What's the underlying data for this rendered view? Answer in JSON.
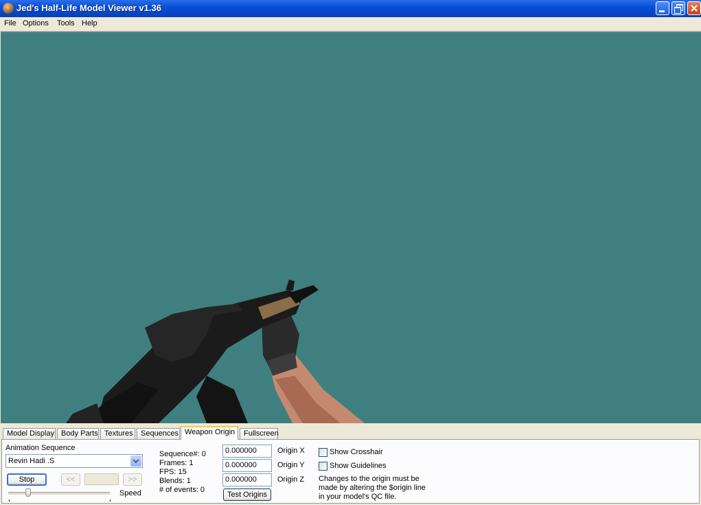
{
  "window": {
    "title": "Jed's Half-Life Model Viewer v1.36"
  },
  "menu": [
    "File",
    "Options",
    "Tools",
    "Help"
  ],
  "tabs": [
    "Model Display",
    "Body Parts",
    "Textures",
    "Sequences",
    "Weapon Origin",
    "Fullscreen"
  ],
  "active_tab": "Weapon Origin",
  "animation": {
    "label": "Animation Sequence",
    "selected": "Revin Hadi .S",
    "stop_label": "Stop",
    "prev_label": "<<",
    "next_label": ">>",
    "speed_label": "Speed",
    "speed_fraction": 0.2
  },
  "stats": {
    "sequence": "Sequence#: 0",
    "frames": "Frames: 1",
    "fps": "FPS: 15",
    "blends": "Blends: 1",
    "events": "# of events: 0"
  },
  "origin": {
    "x_value": "0.000000",
    "y_value": "0.000000",
    "z_value": "0.000000",
    "x_label": "Origin X",
    "y_label": "Origin Y",
    "z_label": "Origin Z",
    "test_label": "Test Origins"
  },
  "options": {
    "crosshair_label": "Show Crosshair",
    "guidelines_label": "Show Guidelines",
    "note_line1": "Changes to the origin must be",
    "note_line2": "made by altering the $origin line",
    "note_line3": "in your model's QC file."
  },
  "colors": {
    "viewport_bg": "#407f7f",
    "title_blue": "#0a4fd6"
  }
}
